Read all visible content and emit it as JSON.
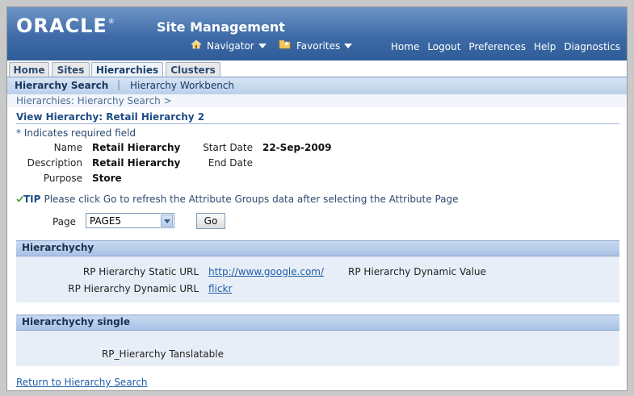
{
  "header": {
    "logo": "ORACLE",
    "logo_mark": "®",
    "app_title": "Site Management",
    "navigator": "Navigator",
    "favorites": "Favorites",
    "global_links": [
      "Home",
      "Logout",
      "Preferences",
      "Help",
      "Diagnostics"
    ]
  },
  "tabs": [
    {
      "label": "Home",
      "active": false
    },
    {
      "label": "Sites",
      "active": false
    },
    {
      "label": "Hierarchies",
      "active": true
    },
    {
      "label": "Clusters",
      "active": false
    }
  ],
  "subnav": {
    "active": "Hierarchy Search",
    "separator": "|",
    "other": "Hierarchy Workbench"
  },
  "breadcrumb": "Hierarchies: Hierarchy Search  >",
  "page_title": "View Hierarchy: Retail Hierarchy 2",
  "required_note": {
    "star": "*",
    "text": "Indicates required field"
  },
  "fields": {
    "name_label": "Name",
    "name_value": "Retail Hierarchy",
    "description_label": "Description",
    "description_value": "Retail Hierarchy",
    "purpose_label": "Purpose",
    "purpose_value": "Store",
    "start_date_label": "Start Date",
    "start_date_value": "22-Sep-2009",
    "end_date_label": "End Date"
  },
  "tip": {
    "label": "TIP",
    "text": "Please click Go to refresh the Attribute Groups data after selecting the Attribute Page"
  },
  "page_select": {
    "label": "Page",
    "value": "PAGE5"
  },
  "go_button": "Go",
  "section1": {
    "title": "Hierarchychy",
    "static_url_label": "RP Hierarchy Static URL",
    "static_url_value": "http://www.google.com/",
    "dynamic_value_label": "RP Hierarchy Dynamic Value",
    "dynamic_url_label": "RP Hierarchy Dynamic URL",
    "dynamic_url_value": "flickr"
  },
  "section2": {
    "title": "Hierarchychy single",
    "translatable_label": "RP_Hierarchy Tanslatable"
  },
  "footer_link": "Return to Hierarchy Search",
  "colors": {
    "banner": "#3e6ba7",
    "section_header": "#a9c2e6",
    "link": "#1f5fa8"
  }
}
